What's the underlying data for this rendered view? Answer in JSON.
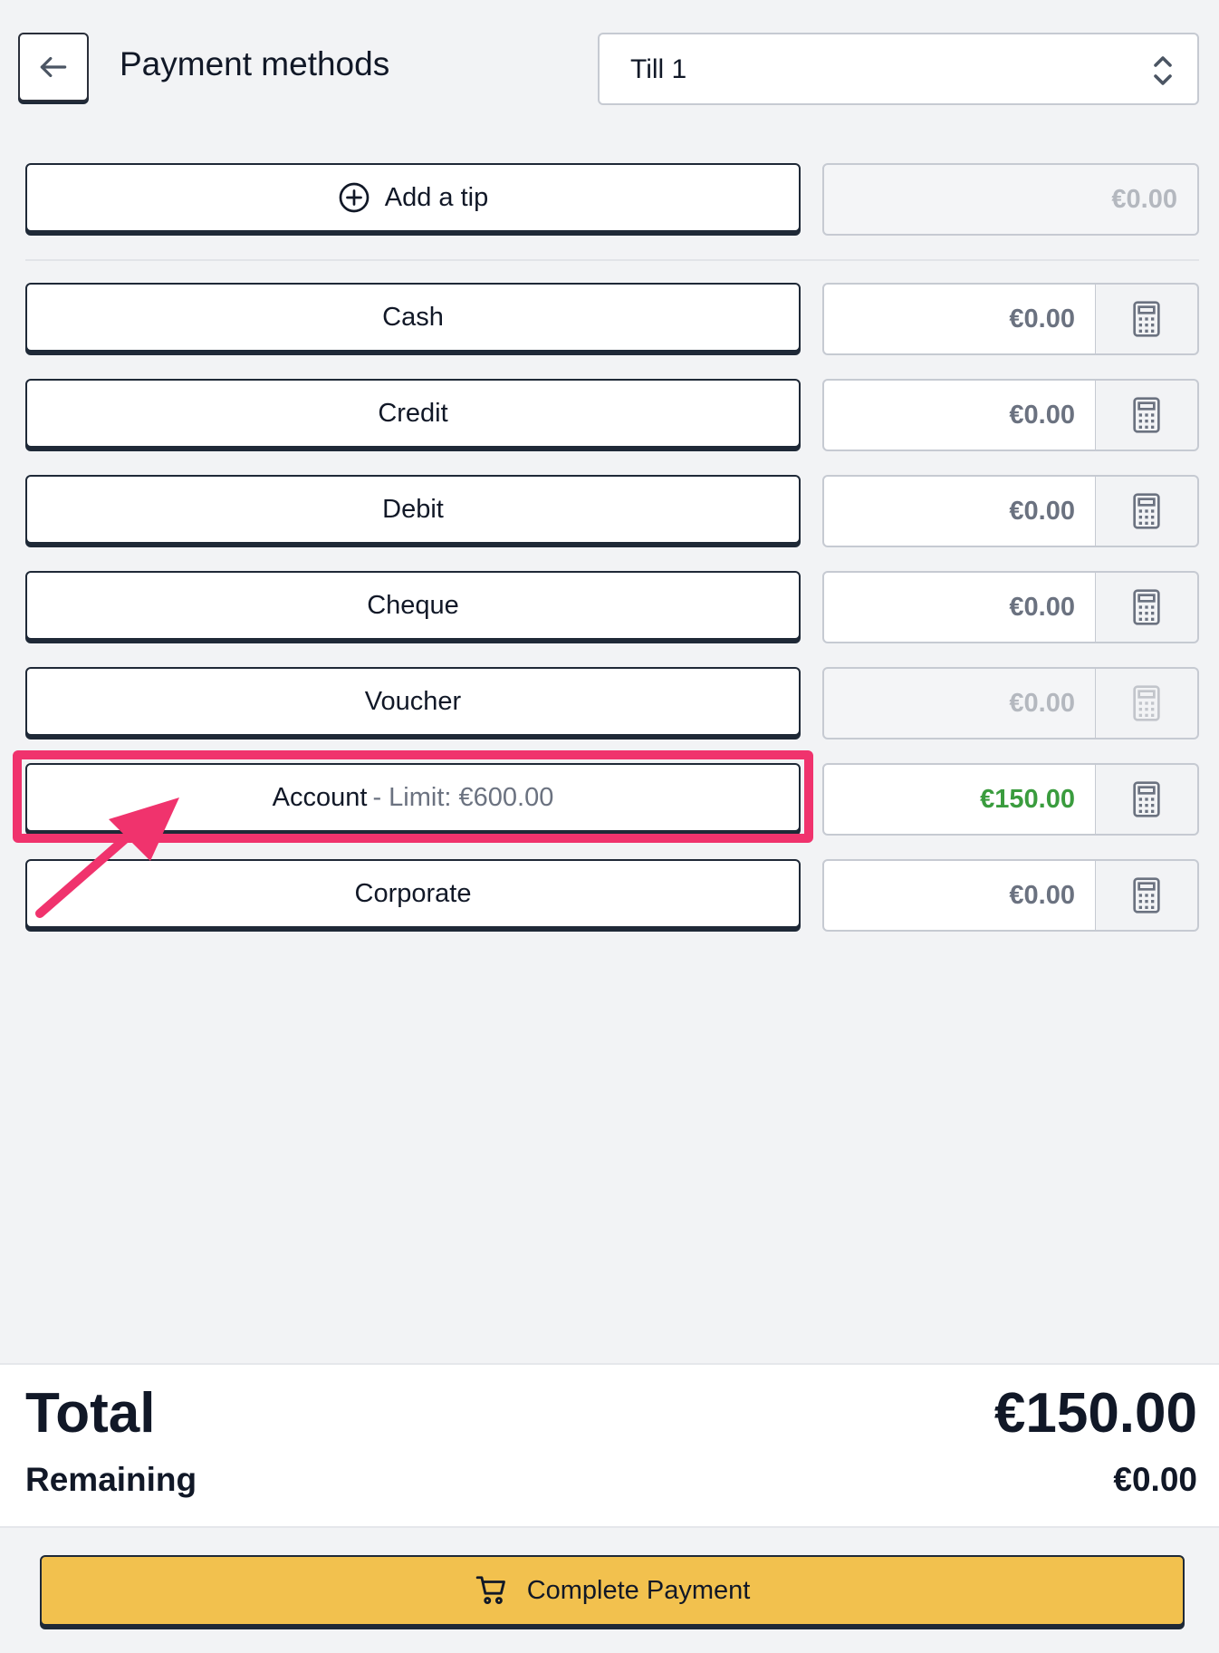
{
  "header": {
    "title": "Payment methods",
    "till": {
      "selected": "Till 1"
    }
  },
  "tip": {
    "label": "Add a tip",
    "amount": "€0.00"
  },
  "methods": [
    {
      "label": "Cash",
      "amount": "€0.00"
    },
    {
      "label": "Credit",
      "amount": "€0.00"
    },
    {
      "label": "Debit",
      "amount": "€0.00"
    },
    {
      "label": "Cheque",
      "amount": "€0.00"
    },
    {
      "label": "Voucher",
      "amount": "€0.00"
    },
    {
      "label": "Account",
      "sub": "- Limit: €600.00",
      "amount": "€150.00"
    },
    {
      "label": "Corporate",
      "amount": "€0.00"
    }
  ],
  "totals": {
    "total_label": "Total",
    "total_value": "€150.00",
    "remaining_label": "Remaining",
    "remaining_value": "€0.00"
  },
  "footer": {
    "complete_label": "Complete Payment"
  },
  "colors": {
    "highlight": "#f0336d",
    "positive": "#3a9c3e",
    "primary": "#f2c14e"
  },
  "icons": [
    "arrow-left-icon",
    "chevron-up-down-icon",
    "plus-circle-icon",
    "calculator-icon",
    "cart-icon",
    "annotation-arrow"
  ]
}
